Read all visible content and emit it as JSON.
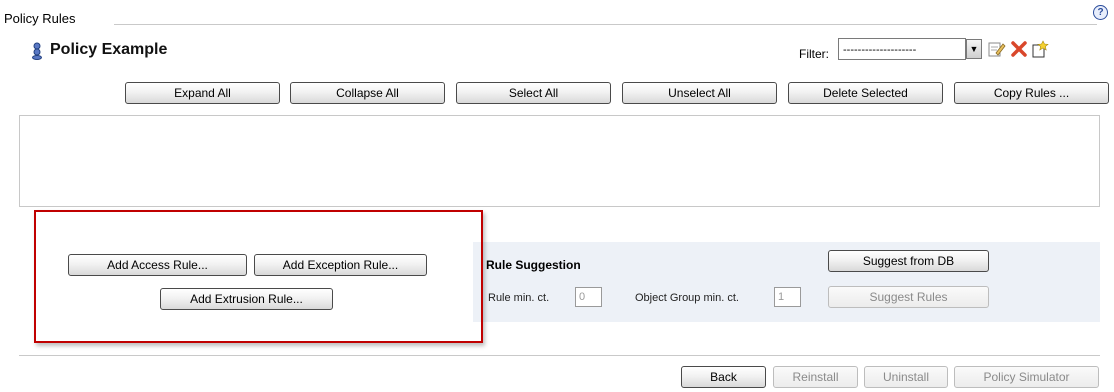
{
  "header": {
    "section_title": "Policy Rules",
    "help_label": "?",
    "policy_name": "Policy Example"
  },
  "filter": {
    "label": "Filter:",
    "value": "--------------------",
    "icons": [
      "edit-icon",
      "delete-icon",
      "new-icon"
    ]
  },
  "toolbar": {
    "expand_all": "Expand All",
    "collapse_all": "Collapse All",
    "select_all": "Select All",
    "unselect_all": "Unselect All",
    "delete_selected": "Delete Selected",
    "copy_rules": "Copy Rules ..."
  },
  "add_rules": {
    "access": "Add Access Rule...",
    "exception": "Add Exception Rule...",
    "extrusion": "Add Extrusion Rule..."
  },
  "suggestion": {
    "title": "Rule Suggestion",
    "suggest_from_db": "Suggest from DB",
    "rule_min_label": "Rule min. ct.",
    "rule_min_value": "0",
    "object_group_label": "Object Group min. ct.",
    "object_group_value": "1",
    "suggest_rules": "Suggest Rules"
  },
  "footer": {
    "back": "Back",
    "reinstall": "Reinstall",
    "uninstall": "Uninstall",
    "policy_simulator": "Policy Simulator"
  },
  "colors": {
    "highlight_border": "#c00000",
    "suggestion_panel_bg": "#edf1f7"
  }
}
